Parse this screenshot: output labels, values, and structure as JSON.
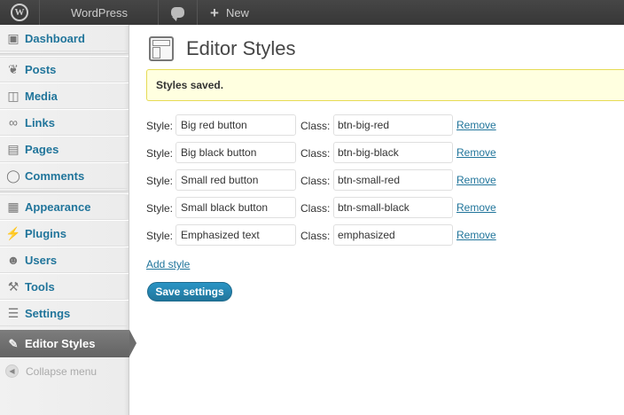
{
  "adminbar": {
    "wp_logo_icon": "wordpress-logo-icon",
    "site_name": "WordPress",
    "comments_icon": "comment-bubble-icon",
    "new_label": "New"
  },
  "sidebar": {
    "items": [
      {
        "label": "Dashboard",
        "icon": "dashboard-icon"
      },
      {
        "label": "Posts",
        "icon": "pushpin-icon"
      },
      {
        "label": "Media",
        "icon": "media-icon"
      },
      {
        "label": "Links",
        "icon": "link-icon"
      },
      {
        "label": "Pages",
        "icon": "page-icon"
      },
      {
        "label": "Comments",
        "icon": "comment-icon"
      },
      {
        "label": "Appearance",
        "icon": "appearance-icon"
      },
      {
        "label": "Plugins",
        "icon": "plugin-icon"
      },
      {
        "label": "Users",
        "icon": "users-icon"
      },
      {
        "label": "Tools",
        "icon": "tools-icon"
      },
      {
        "label": "Settings",
        "icon": "settings-icon"
      }
    ],
    "active": {
      "label": "Editor Styles",
      "icon": "editor-styles-icon"
    },
    "collapse_label": "Collapse menu"
  },
  "main": {
    "title": "Editor Styles",
    "notice": "Styles saved.",
    "style_label": "Style:",
    "class_label": "Class:",
    "remove_label": "Remove",
    "rows": [
      {
        "name": "Big red button",
        "class": "btn-big-red"
      },
      {
        "name": "Big black button",
        "class": "btn-big-black"
      },
      {
        "name": "Small red button",
        "class": "btn-small-red"
      },
      {
        "name": "Small black button",
        "class": "btn-small-black"
      },
      {
        "name": "Emphasized text",
        "class": "emphasized"
      }
    ],
    "add_style": "Add style",
    "save_button": "Save settings"
  },
  "colors": {
    "link": "#21759b",
    "notice_bg": "#ffffe0",
    "notice_border": "#e6db55",
    "adminbar_bg": "#464646"
  }
}
